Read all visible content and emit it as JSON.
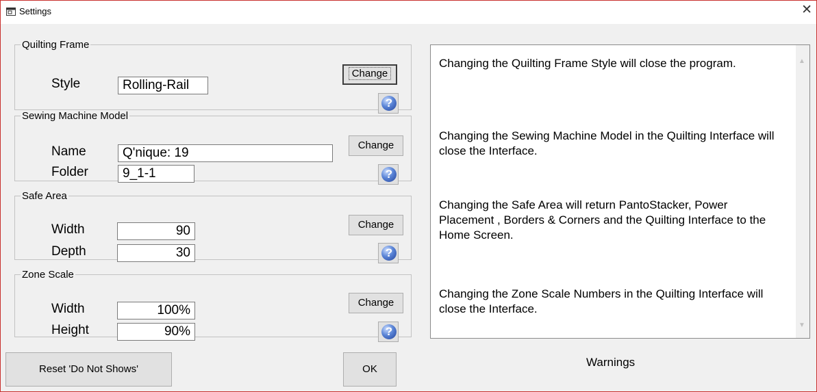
{
  "window": {
    "title": "Settings",
    "close_glyph": "✕"
  },
  "quilting_frame": {
    "legend": "Quilting Frame",
    "style_label": "Style",
    "style_value": "Rolling-Rail",
    "change_label": "Change"
  },
  "sewing_machine": {
    "legend": "Sewing Machine Model",
    "name_label": "Name",
    "name_value": "Q'nique: 19",
    "folder_label": "Folder",
    "folder_value": "9_1-1",
    "change_label": "Change"
  },
  "safe_area": {
    "legend": "Safe Area",
    "width_label": "Width",
    "width_value": "90",
    "depth_label": "Depth",
    "depth_value": "30",
    "change_label": "Change"
  },
  "zone_scale": {
    "legend": "Zone Scale",
    "width_label": "Width",
    "width_value": "100%",
    "height_label": "Height",
    "height_value": "90%",
    "change_label": "Change"
  },
  "help_glyph": "?",
  "warnings": {
    "items": [
      "Changing the Quilting Frame Style will close the program.",
      "Changing the Sewing Machine Model in the Quilting Interface will close the Interface.",
      "Changing the Safe Area will return PantoStacker, Power Placement , Borders & Corners and the Quilting Interface to the Home Screen.",
      "Changing the Zone Scale Numbers in the Quilting Interface will close the Interface."
    ],
    "label": "Warnings"
  },
  "buttons": {
    "reset_label": "Reset 'Do Not Shows'",
    "ok_label": "OK"
  },
  "icons": {
    "window": "window-icon",
    "close": "close-icon",
    "help": "help-icon",
    "scroll_up": "chevron-up-icon",
    "scroll_down": "chevron-down-icon"
  }
}
